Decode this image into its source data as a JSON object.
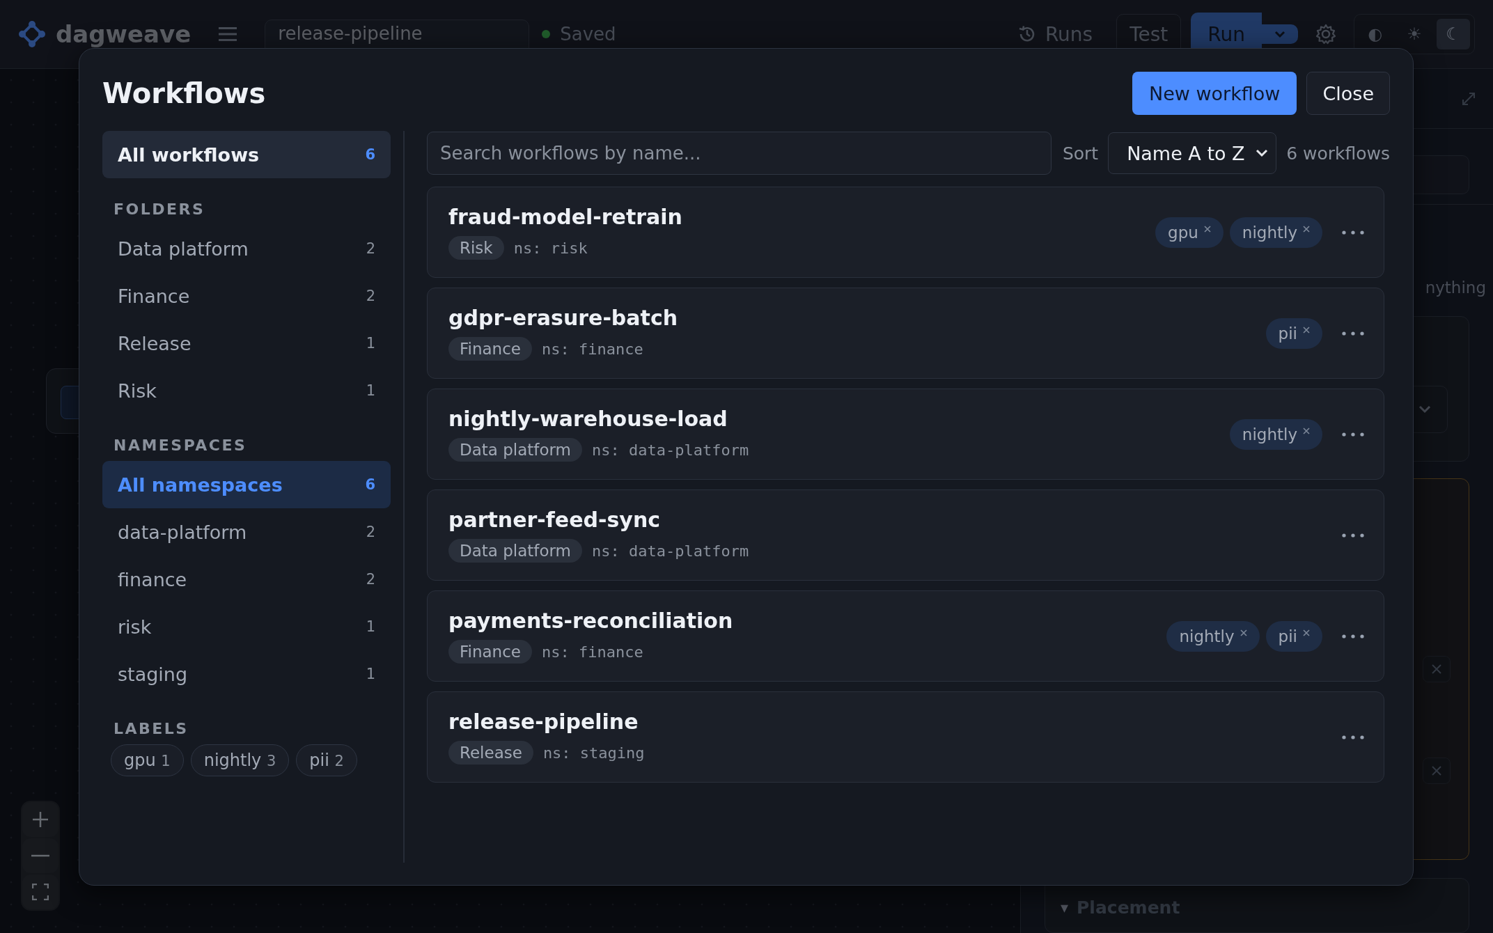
{
  "topbar": {
    "brand": "dagweave",
    "workflow_name": "release-pipeline",
    "save_status": "Saved",
    "runs": "Runs",
    "test": "Test",
    "run": "Run",
    "theme_modes": [
      {
        "glyph": "◐",
        "selected": false
      },
      {
        "glyph": "☀",
        "selected": false
      },
      {
        "glyph": "☾",
        "selected": true
      }
    ]
  },
  "right_panel": {
    "hint_fragment": "nything",
    "section": "Placement",
    "section_toggle": "▾"
  },
  "modal": {
    "title": "Workflows",
    "new_button": "New workflow",
    "close_button": "Close",
    "sidebar": {
      "all_workflows": {
        "label": "All workflows",
        "count": "6",
        "selected": true
      },
      "folders_heading": "FOLDERS",
      "folders": [
        {
          "label": "Data platform",
          "count": "2",
          "selected": false
        },
        {
          "label": "Finance",
          "count": "2",
          "selected": false
        },
        {
          "label": "Release",
          "count": "1",
          "selected": false
        },
        {
          "label": "Risk",
          "count": "1",
          "selected": false
        }
      ],
      "namespaces_heading": "NAMESPACES",
      "namespaces": [
        {
          "label": "All namespaces",
          "count": "6",
          "selected": true
        },
        {
          "label": "data-platform",
          "count": "2",
          "selected": false
        },
        {
          "label": "finance",
          "count": "2",
          "selected": false
        },
        {
          "label": "risk",
          "count": "1",
          "selected": false
        },
        {
          "label": "staging",
          "count": "1",
          "selected": false
        }
      ],
      "labels_heading": "LABELS",
      "labels": [
        {
          "name": "gpu",
          "count": "1"
        },
        {
          "name": "nightly",
          "count": "3"
        },
        {
          "name": "pii",
          "count": "2"
        }
      ]
    },
    "search": {
      "placeholder": "Search workflows by name..."
    },
    "sort_label": "Sort",
    "sort_value": "Name A to Z",
    "result_count": "6 workflows",
    "workflows": [
      {
        "name": "fraud-model-retrain",
        "folder": "Risk",
        "namespace": "ns: risk",
        "tags": [
          "gpu",
          "nightly"
        ]
      },
      {
        "name": "gdpr-erasure-batch",
        "folder": "Finance",
        "namespace": "ns: finance",
        "tags": [
          "pii"
        ]
      },
      {
        "name": "nightly-warehouse-load",
        "folder": "Data platform",
        "namespace": "ns: data-platform",
        "tags": [
          "nightly"
        ]
      },
      {
        "name": "partner-feed-sync",
        "folder": "Data platform",
        "namespace": "ns: data-platform"
      },
      {
        "name": "payments-reconciliation",
        "folder": "Finance",
        "namespace": "ns: finance",
        "tags": [
          "nightly",
          "pii"
        ]
      },
      {
        "name": "release-pipeline",
        "folder": "Release",
        "namespace": "ns: staging"
      }
    ]
  }
}
